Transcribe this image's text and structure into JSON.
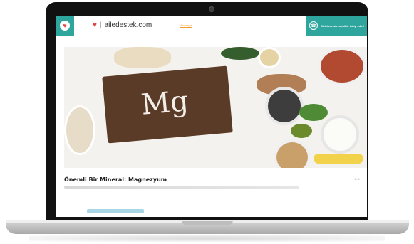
{
  "site": {
    "brand": "ailedestek.com",
    "nav": [
      "Anasayfa",
      "",
      "",
      "",
      ""
    ],
    "active_nav_index": 0,
    "cta_label": "Bizi ücretsiz mobilde takip edin!"
  },
  "hero": {
    "board_text": "Mg"
  },
  "article": {
    "title": "Önemli Bir Mineral: Magnezyum",
    "page_indicator": "1 / 1"
  },
  "colors": {
    "accent": "#2ea59d",
    "nav_active": "#f39b2a",
    "heart": "#e0463f"
  },
  "icons": {
    "logo": "heart-icon",
    "cta": "phone-icon"
  }
}
